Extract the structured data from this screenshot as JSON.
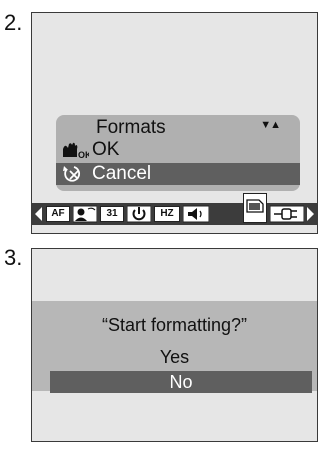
{
  "step2": {
    "number": "2.",
    "menu": {
      "title": "Formats",
      "items": [
        {
          "label": "OK",
          "icon": "ok-hand-icon",
          "icon_text": "OK"
        },
        {
          "label": "Cancel",
          "icon": "cancel-undo-icon",
          "selected": true
        }
      ]
    },
    "toolbar": {
      "items": [
        {
          "icon": "arrow-left-icon"
        },
        {
          "icon": "autofocus-icon",
          "text": "AF"
        },
        {
          "icon": "portrait-mode-icon"
        },
        {
          "icon": "calendar-icon",
          "text": "31"
        },
        {
          "icon": "power-icon"
        },
        {
          "icon": "hz-icon",
          "text": "HZ"
        },
        {
          "icon": "speaker-icon"
        },
        {
          "icon": "memory-card-icon",
          "selected": true
        },
        {
          "icon": "plug-icon"
        },
        {
          "icon": "arrow-right-icon"
        }
      ]
    }
  },
  "step3": {
    "number": "3.",
    "dialog": {
      "question": "“Start formatting?”",
      "options": [
        {
          "label": "Yes"
        },
        {
          "label": "No",
          "selected": true
        }
      ]
    }
  },
  "colors": {
    "screen_bg": "#e6e6e6",
    "menu_bg": "#b0b0b0",
    "highlight": "#5f5f5f",
    "toolbar_bg": "#3c3c3c"
  }
}
